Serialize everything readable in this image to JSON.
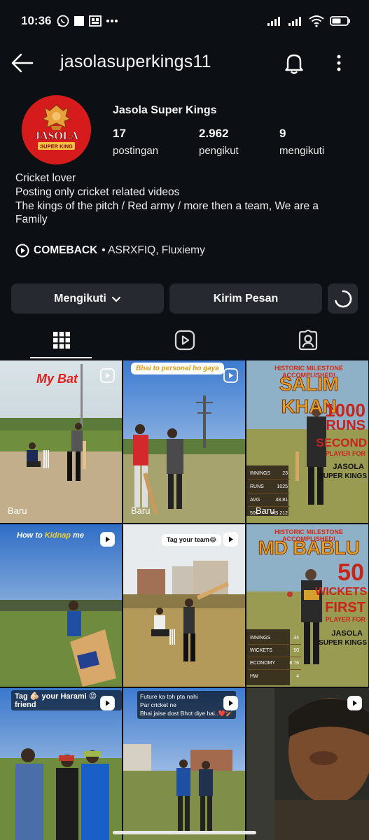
{
  "status_bar": {
    "time": "10:36",
    "battery_level": 0.6
  },
  "header": {
    "username": "jasolasuperkings11"
  },
  "profile": {
    "avatar_text_top": "JASOLA",
    "avatar_text_bottom": "SUPER KING",
    "display_name": "Jasola Super Kings",
    "stats": [
      {
        "value": "17",
        "label": "postingan"
      },
      {
        "value": "2.962",
        "label": "pengikut"
      },
      {
        "value": "9",
        "label": "mengikuti"
      }
    ],
    "bio_lines": [
      "Cricket lover",
      "Posting only cricket related videos",
      "The kings of the pitch / Red army / more then a team, We are a",
      "Family"
    ],
    "music_title": "COMEBACK",
    "music_artists": "• ASRXFIQ, Fluxiemy"
  },
  "actions": {
    "follow_label": "Mengikuti",
    "message_label": "Kirim Pesan"
  },
  "grid": {
    "new_label": "Baru",
    "posts": [
      {
        "caption": "My Bat"
      },
      {
        "caption": "Bhai to personal ho gaya"
      },
      {
        "headline": "HISTORIC MILESTONE ACCOMPLISHED!",
        "name": "SALIM KHAN",
        "big": "1000",
        "big2": "RUNS",
        "rank": "SECOND",
        "rank2": "PLAYER FOR",
        "team1": "JASOLA",
        "team2": "SUPER KINGS",
        "stats": [
          {
            "k": "INNINGS",
            "v": "23"
          },
          {
            "k": "RUNS",
            "v": "1025"
          },
          {
            "k": "AVG",
            "v": "48.81"
          },
          {
            "k": "50s",
            "v": "HS 212"
          }
        ]
      },
      {
        "caption_a": "How to ",
        "caption_b": "Kidnap",
        "caption_c": " me"
      },
      {
        "caption": "Tag your team😂"
      },
      {
        "headline": "HISTORIC MILESTONE ACCOMPLISHED!",
        "name": "MD BABLU",
        "big": "50",
        "big2": "WICKETS",
        "rank": "FIRST",
        "rank2": "PLAYER FOR",
        "team1": "JASOLA",
        "team2": "SUPER KINGS",
        "stats": [
          {
            "k": "INNINGS",
            "v": "34"
          },
          {
            "k": "WICKETS",
            "v": "50"
          },
          {
            "k": "ECONOMY",
            "v": "8.76"
          },
          {
            "k": "HW",
            "v": "4"
          }
        ]
      },
      {
        "caption": "Tag 🫵🏻 your Harami 😡 friend"
      },
      {
        "caption_l1": "Future ka toh pta nahi",
        "caption_l2": "Par cricket ne",
        "caption_l3": "Bhai jaise dost Bhot diye hai..❤️🏏"
      },
      {}
    ]
  }
}
